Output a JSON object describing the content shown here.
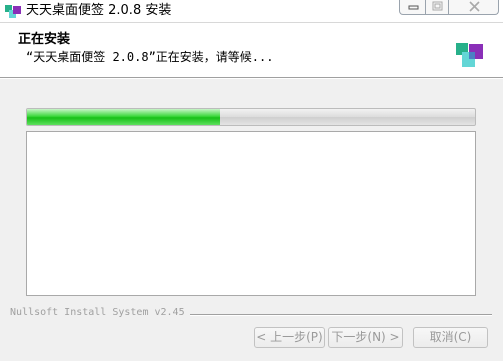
{
  "window": {
    "title": "天天桌面便签 2.0.8 安装",
    "icon": "app-logo-icon",
    "caption_buttons": [
      "minimize-icon",
      "maximize-icon",
      "close-icon"
    ]
  },
  "header": {
    "title": "正在安装",
    "subtitle": "“天天桌面便签 2.0.8”正在安装，请等候...",
    "logo": "app-logo-icon"
  },
  "progress": {
    "value": 0.43
  },
  "details": {
    "lines": []
  },
  "branding": {
    "text": "Nullsoft Install System v2.45"
  },
  "buttons": {
    "back": "< 上一步(P)",
    "next": "下一步(N) >",
    "cancel": "取消(C)"
  },
  "colors": {
    "progress_fill": "#22c822",
    "logo_green": "#27b08a",
    "logo_cyan": "#63d6d6",
    "logo_purple": "#8a2fb8"
  }
}
